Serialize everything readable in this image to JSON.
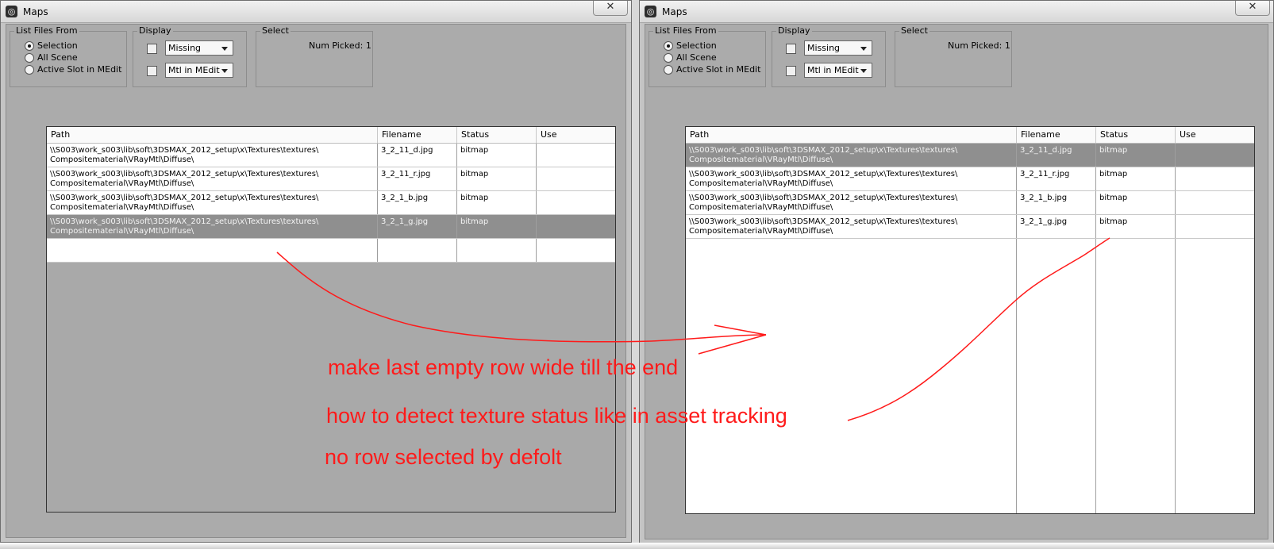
{
  "left_window": {
    "title": "Maps",
    "close_label": "✕",
    "list_group": {
      "title": "List Files From",
      "options": [
        "Selection",
        "All Scene",
        "Active Slot in MEdit"
      ],
      "selected": "Selection"
    },
    "display_group": {
      "title": "Display",
      "dropdown1": "Missing",
      "dropdown2": "Mtl in MEdit"
    },
    "select_group": {
      "title": "Select",
      "num_picked": "Num Picked: 1"
    },
    "table": {
      "headers": [
        "Path",
        "Filename",
        "Status",
        "Use"
      ],
      "rows": [
        {
          "path1": "\\\\S003\\work_s003\\lib\\soft\\3DSMAX_2012_setup\\x\\Textures\\textures\\",
          "path2": "Compositematerial\\VRayMtl\\Diffuse\\",
          "filename": "3_2_11_d.jpg",
          "status": "bitmap",
          "use": ""
        },
        {
          "path1": "\\\\S003\\work_s003\\lib\\soft\\3DSMAX_2012_setup\\x\\Textures\\textures\\",
          "path2": "Compositematerial\\VRayMtl\\Diffuse\\",
          "filename": "3_2_11_r.jpg",
          "status": "bitmap",
          "use": ""
        },
        {
          "path1": "\\\\S003\\work_s003\\lib\\soft\\3DSMAX_2012_setup\\x\\Textures\\textures\\",
          "path2": "Compositematerial\\VRayMtl\\Diffuse\\",
          "filename": "3_2_1_b.jpg",
          "status": "bitmap",
          "use": ""
        },
        {
          "path1": "\\\\S003\\work_s003\\lib\\soft\\3DSMAX_2012_setup\\x\\Textures\\textures\\",
          "path2": "Compositematerial\\VRayMtl\\Diffuse\\",
          "filename": "3_2_1_g.jpg",
          "status": "bitmap",
          "use": ""
        }
      ],
      "selected_row_index": 3
    }
  },
  "right_window": {
    "title": "Maps",
    "close_label": "✕",
    "list_group": {
      "title": "List Files From",
      "options": [
        "Selection",
        "All Scene",
        "Active Slot in MEdit"
      ],
      "selected": "Selection"
    },
    "display_group": {
      "title": "Display",
      "dropdown1": "Missing",
      "dropdown2": "Mtl in MEdit"
    },
    "select_group": {
      "title": "Select",
      "num_picked": "Num Picked: 1"
    },
    "table": {
      "headers": [
        "Path",
        "Filename",
        "Status",
        "Use"
      ],
      "rows": [
        {
          "path1": "\\\\S003\\work_s003\\lib\\soft\\3DSMAX_2012_setup\\x\\Textures\\textures\\",
          "path2": "Compositematerial\\VRayMtl\\Diffuse\\",
          "filename": "3_2_11_d.jpg",
          "status": "bitmap",
          "use": ""
        },
        {
          "path1": "\\\\S003\\work_s003\\lib\\soft\\3DSMAX_2012_setup\\x\\Textures\\textures\\",
          "path2": "Compositematerial\\VRayMtl\\Diffuse\\",
          "filename": "3_2_11_r.jpg",
          "status": "bitmap",
          "use": ""
        },
        {
          "path1": "\\\\S003\\work_s003\\lib\\soft\\3DSMAX_2012_setup\\x\\Textures\\textures\\",
          "path2": "Compositematerial\\VRayMtl\\Diffuse\\",
          "filename": "3_2_1_b.jpg",
          "status": "bitmap",
          "use": ""
        },
        {
          "path1": "\\\\S003\\work_s003\\lib\\soft\\3DSMAX_2012_setup\\x\\Textures\\textures\\",
          "path2": "Compositematerial\\VRayMtl\\Diffuse\\",
          "filename": "3_2_1_g.jpg",
          "status": "bitmap",
          "use": ""
        }
      ],
      "selected_row_index": 0
    }
  },
  "annotations": {
    "note1": "make last empty row wide till the end",
    "note2": "how to detect texture status like in asset tracking",
    "note3": "no row selected by defolt",
    "color": "#ff1a1a"
  },
  "colors": {
    "panel_bg": "#ababab",
    "window_bg": "#c4c4c4",
    "selected_row": "#8f8f8f",
    "annotation": "#ff1a1a"
  }
}
